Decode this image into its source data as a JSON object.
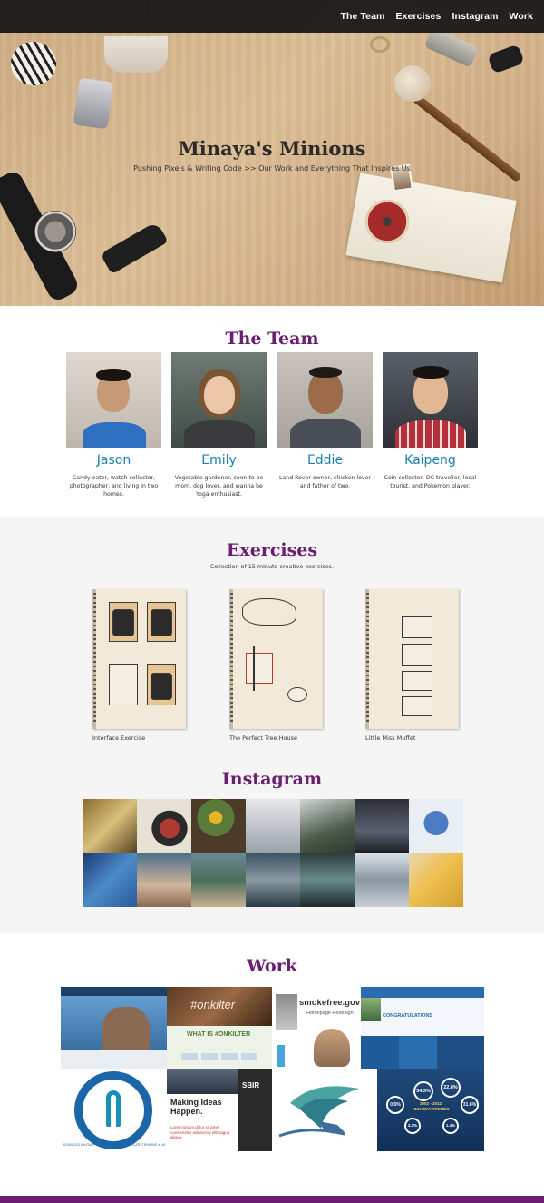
{
  "nav": {
    "links": [
      "The Team",
      "Exercises",
      "Instagram",
      "Work"
    ]
  },
  "hero": {
    "title": "Minaya's Minions",
    "subtitle": "Pushing Pixels & Writing Code >> Our Work and Everything That Inspires Us"
  },
  "team": {
    "title": "The Team",
    "members": [
      {
        "name": "Jason",
        "bio": "Candy eater, watch collector, photographer, and living in two homes."
      },
      {
        "name": "Emily",
        "bio": "Vegetable gardener, soon to be mom, dog lover, and wanna be Yoga enthusiast."
      },
      {
        "name": "Eddie",
        "bio": "Land Rover owner, chicken lover and father of two."
      },
      {
        "name": "Kaipeng",
        "bio": "Coin collector, DC traveller, local tourist, and Pokemon player."
      }
    ]
  },
  "exercises": {
    "title": "Exercises",
    "description": "Collection of 15 minute creative exercises.",
    "items": [
      "Interface Exercise",
      "The Perfect Tree House",
      "Little Miss Muffet"
    ]
  },
  "instagram": {
    "title": "Instagram"
  },
  "work": {
    "title": "Work",
    "tiles": {
      "onkilter_tag": "#onkilter",
      "what_is": "WHAT IS #ONKILTER",
      "smokefree": "smokefree.gov",
      "smokefree_sub": "Homepage Redesign",
      "congrats": "CONGRATULATIONS",
      "making_ideas": "Making Ideas Happen.",
      "sbir": "SBIR",
      "lorem": "Lorem ipsum dolor sit amet consectetur adipiscing elitmagna aliqua.",
      "seal": "ADVANCED MILITARY SEXUAL ASSAULT ADVOCATE TRAINING ★ AMSAAT ★",
      "stat1": "54.3%",
      "stat2": "22.8%",
      "stat3": "0.5%",
      "stat4": "31.6%",
      "stat5": "3.2%",
      "stat6": "1.4%",
      "trends": "2002 - 2012 HIGHWAY TRENDS"
    }
  },
  "colors": {
    "accent": "#6a1f70",
    "name_link": "#1a7fb0",
    "nav_bg": "#141414"
  }
}
